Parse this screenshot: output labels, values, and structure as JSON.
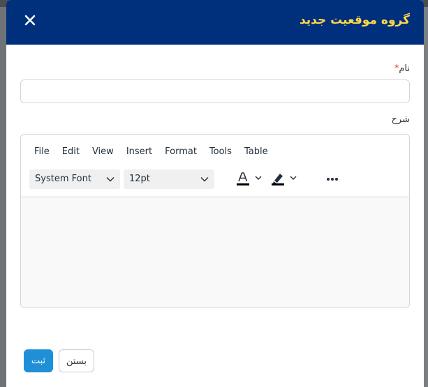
{
  "modal": {
    "title": "گروه موقعیت جدید",
    "close_icon": "close-icon"
  },
  "form": {
    "name_label": "نام",
    "required_mark": "*",
    "name_value": "",
    "description_label": "شرح"
  },
  "editor": {
    "menu": [
      "File",
      "Edit",
      "View",
      "Insert",
      "Format",
      "Tools",
      "Table"
    ],
    "font_family": "System Font",
    "font_size": "12pt",
    "icons": [
      "text-color-icon",
      "highlight-color-icon",
      "more-options-icon"
    ],
    "content": ""
  },
  "buttons": {
    "submit_label": "ثبت",
    "close_label": "بستن"
  },
  "colors": {
    "header_bg": "#002f7b",
    "title": "#ffd84a",
    "primary": "#1f8fd8",
    "required": "#e23b3b"
  }
}
